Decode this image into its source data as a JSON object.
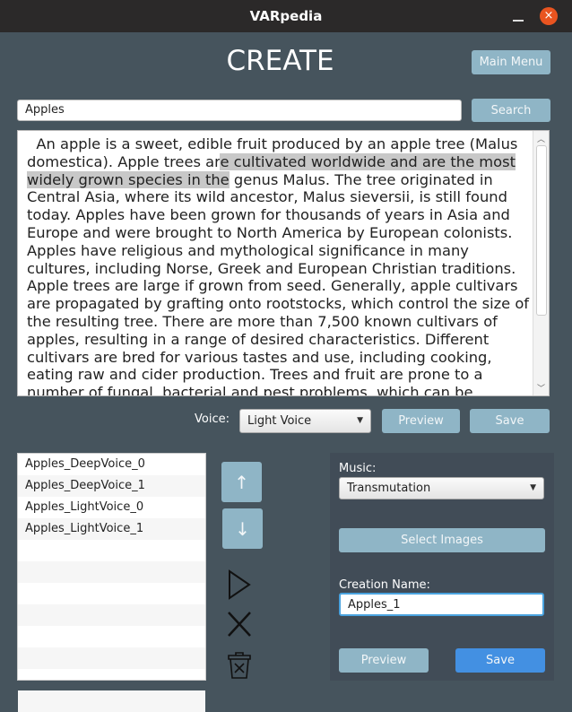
{
  "window": {
    "title": "VARpedia",
    "close_glyph": "×"
  },
  "page": {
    "title": "CREATE",
    "main_menu_label": "Main Menu"
  },
  "search": {
    "value": "Apples",
    "button_label": "Search"
  },
  "article": {
    "lines": [
      {
        "pre": "  An apple is a sweet, edible fruit produced by an apple tree (Malus",
        "hl": "",
        "post": ""
      },
      {
        "pre": "domestica). Apple trees ar",
        "hl": "e cultivated worldwide and are the most",
        "post": ""
      },
      {
        "pre": "",
        "hl": "widely grown species in the",
        "post": " genus Malus. The tree originated in"
      },
      {
        "pre": "Central Asia, where its wild ancestor, Malus sieversii, is still found",
        "hl": "",
        "post": ""
      },
      {
        "pre": "today. Apples have been grown for thousands of years in Asia and",
        "hl": "",
        "post": ""
      },
      {
        "pre": "Europe and were brought to North America by European colonists.",
        "hl": "",
        "post": ""
      },
      {
        "pre": "Apples have religious and mythological significance in many",
        "hl": "",
        "post": ""
      },
      {
        "pre": "cultures, including Norse, Greek and European Christian traditions.",
        "hl": "",
        "post": ""
      },
      {
        "pre": "Apple trees are large if grown from seed. Generally, apple cultivars",
        "hl": "",
        "post": ""
      },
      {
        "pre": "are propagated by grafting onto rootstocks, which control the size of",
        "hl": "",
        "post": ""
      },
      {
        "pre": "the resulting tree. There are more than 7,500 known cultivars of",
        "hl": "",
        "post": ""
      },
      {
        "pre": "apples, resulting in a range of desired characteristics. Different",
        "hl": "",
        "post": ""
      },
      {
        "pre": "cultivars are bred for various tastes and use, including cooking,",
        "hl": "",
        "post": ""
      },
      {
        "pre": "eating raw and cider production. Trees and fruit are prone to a",
        "hl": "",
        "post": ""
      },
      {
        "pre": "number of fungal, bacterial and pest problems, which can be",
        "hl": "",
        "post": ""
      }
    ]
  },
  "voice": {
    "label": "Voice:",
    "selected": "Light Voice",
    "preview_label": "Preview",
    "save_label": "Save"
  },
  "clips": [
    "Apples_DeepVoice_0",
    "Apples_DeepVoice_1",
    "Apples_LightVoice_0",
    "Apples_LightVoice_1",
    "",
    "",
    "",
    "",
    "",
    "",
    "",
    ""
  ],
  "controls": {
    "up_glyph": "↑",
    "down_glyph": "↓"
  },
  "creation": {
    "music_label": "Music:",
    "music_selected": "Transmutation",
    "select_images_label": "Select Images",
    "name_label": "Creation Name:",
    "name_value": "Apples_1",
    "preview_label": "Preview",
    "save_label": "Save"
  },
  "colors": {
    "background": "#46545d",
    "button": "#8fb5c6",
    "primary": "#4390e2",
    "close": "#e95420"
  }
}
